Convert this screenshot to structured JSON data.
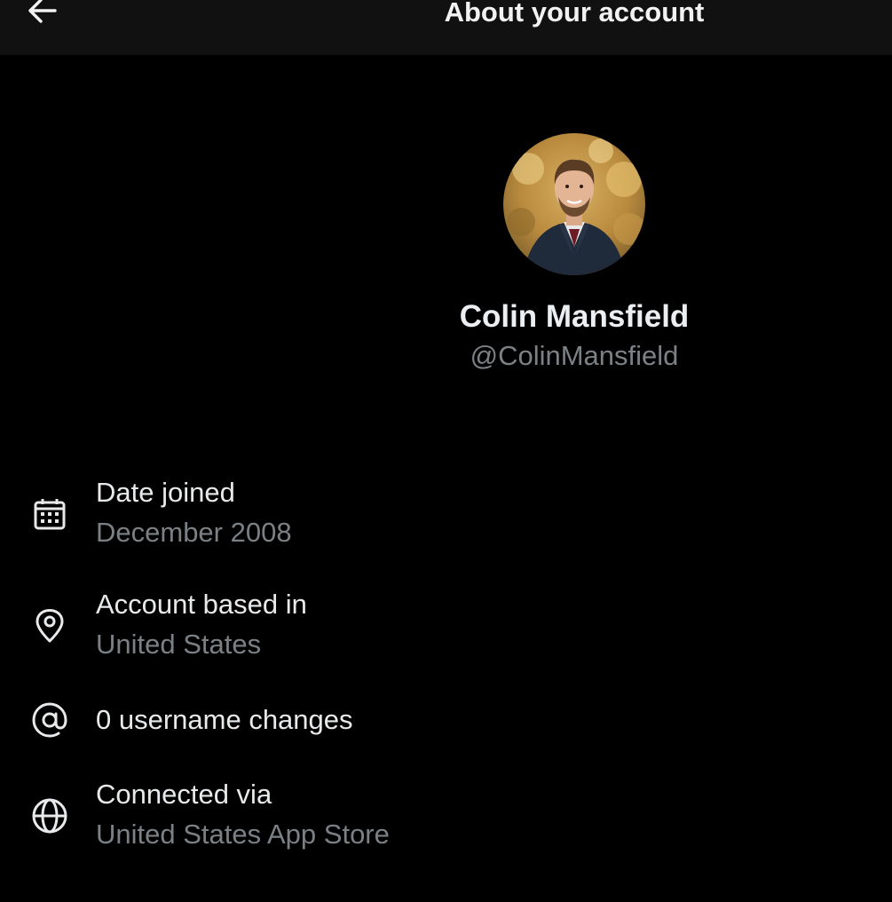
{
  "header": {
    "title": "About your account",
    "back_icon": "arrow-left-icon"
  },
  "profile": {
    "display_name": "Colin Mansfield",
    "handle": "@ColinMansfield",
    "avatar": "profile-photo"
  },
  "details": [
    {
      "icon": "calendar-icon",
      "title": "Date joined",
      "value": "December 2008"
    },
    {
      "icon": "location-pin-icon",
      "title": "Account based in",
      "value": "United States"
    },
    {
      "icon": "at-sign-icon",
      "title": "0 username changes"
    },
    {
      "icon": "globe-icon",
      "title": "Connected via",
      "value": "United States App Store"
    }
  ],
  "colors": {
    "background": "#000000",
    "header_background": "#111111",
    "primary_text": "#e7e9ea",
    "secondary_text": "#7b8085"
  }
}
